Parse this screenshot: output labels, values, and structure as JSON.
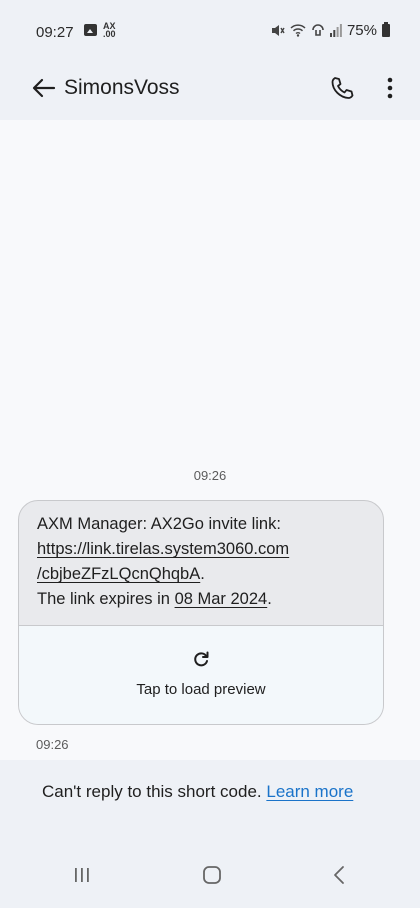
{
  "status_bar": {
    "time": "09:27",
    "ax_badge_top": "AX",
    "ax_badge_bottom": ".00",
    "battery": "75%",
    "icons": [
      "image-icon",
      "ax-notification-icon",
      "mute-icon",
      "wifi-icon",
      "volte-icon",
      "signal-icon",
      "battery-icon"
    ]
  },
  "app_bar": {
    "contact_name": "SimonsVoss",
    "icons": [
      "back-arrow-icon",
      "phone-icon",
      "more-vert-icon"
    ]
  },
  "conversation": {
    "timestamp_header": "09:26",
    "message": {
      "line1": "AXM Manager: AX2Go invite link:",
      "link_part1": "https://link.tirelas.system3060.com",
      "link_part2": "/cbjbeZFzLQcnQhqbA",
      "link_suffix": ".",
      "expiry_prefix": "The link expires in ",
      "expiry_date": "08 Mar 2024",
      "expiry_suffix": "."
    },
    "preview_label": "Tap to load preview",
    "message_time": "09:26"
  },
  "reply_notice": {
    "text": "Can't reply to this short code. ",
    "learn_more": "Learn more"
  },
  "nav_bar": {
    "icons": [
      "recents-icon",
      "home-icon",
      "back-icon"
    ]
  }
}
